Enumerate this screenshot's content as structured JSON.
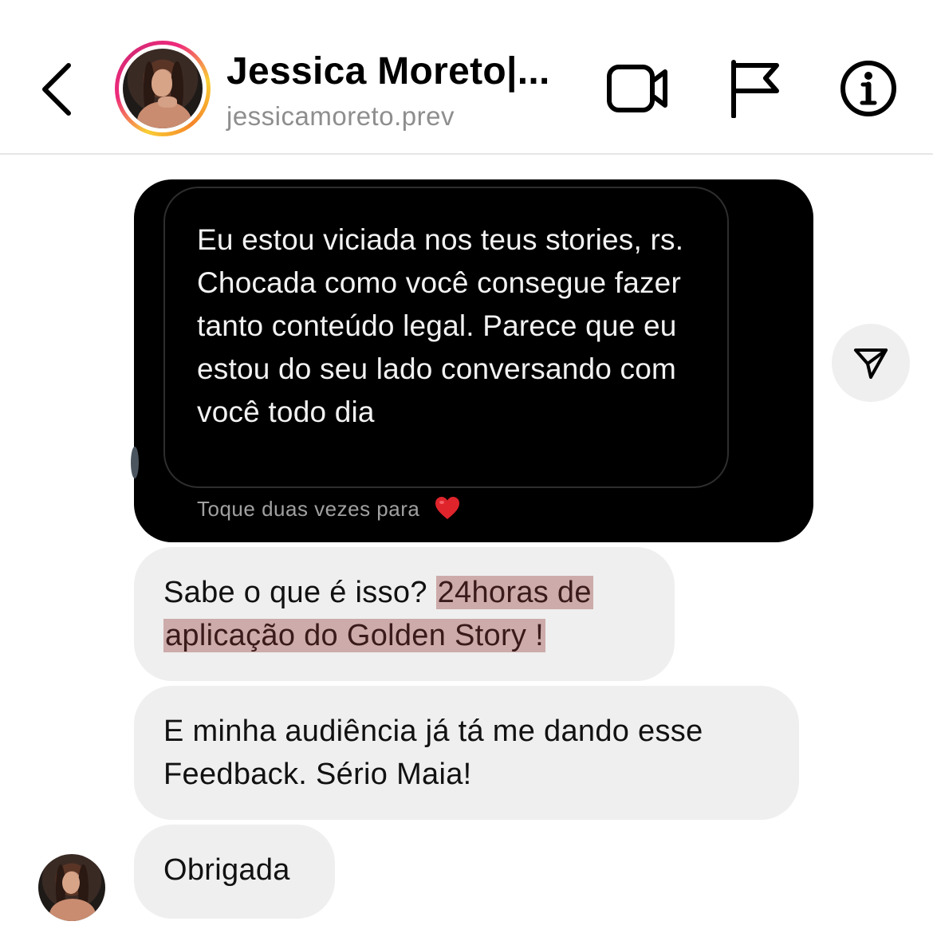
{
  "header": {
    "back_icon": "chevron-left-icon",
    "contact_name": "Jessica Moreto|...",
    "contact_username": "jessicamoreto.prev",
    "actions": [
      "video-call-icon",
      "flag-icon",
      "info-icon"
    ]
  },
  "messages": {
    "story_reply": {
      "text": "Eu estou viciada nos teus stories, rs. Chocada como você consegue fazer tanto conteúdo legal. Parece que eu estou do seu lado conversando com você todo dia",
      "hint": "Toque duas vezes para",
      "hint_icon": "heart-icon"
    },
    "share_icon": "paper-plane-icon",
    "bubble_1": {
      "prefix": "Sabe o que é isso? ",
      "highlight": "24horas de aplicação do Golden Story !"
    },
    "bubble_2": {
      "text": "E minha audiência já tá me dando esse Feedback. Sério Maia!"
    },
    "bubble_3": {
      "text": "Obrigada"
    }
  },
  "colors": {
    "story_bg": "#000000",
    "bubble_bg": "#efefef",
    "highlight": "#c49494",
    "username": "#8e8e8e"
  }
}
